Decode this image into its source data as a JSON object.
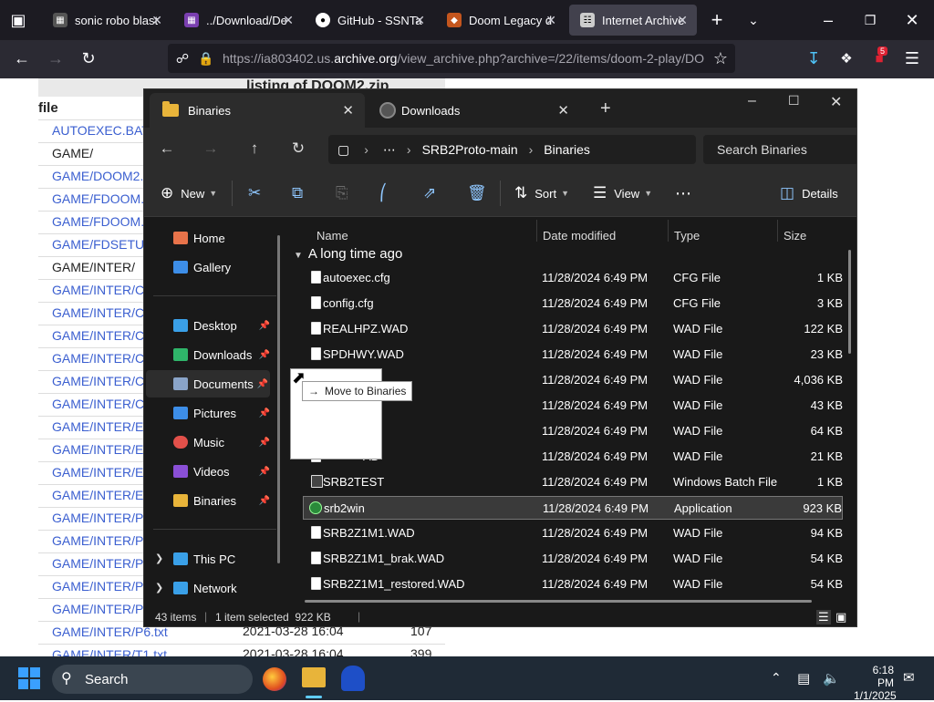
{
  "browser": {
    "tabs": [
      {
        "label": "sonic robo blast",
        "icon": "page-icon"
      },
      {
        "label": "../Download/De",
        "icon": "page-icon"
      },
      {
        "label": "GitHub - SSNTa",
        "icon": "github-icon"
      },
      {
        "label": "Doom Legacy d",
        "icon": "page-icon"
      },
      {
        "label": "Internet Archive",
        "icon": "archive-icon"
      }
    ],
    "url_prefix": "https://ia803402.us.",
    "url_domain": "archive.org",
    "url_rest": "/view_archive.php?archive=/22/items/doom-2-play/DO",
    "extension_badge": "5"
  },
  "webpage": {
    "title": "listing of DOOM2.zip",
    "column_header": "file",
    "rows": [
      "AUTOEXEC.BAT",
      "GAME/",
      "GAME/DOOM2.",
      "GAME/FDOOM.",
      "GAME/FDOOM.",
      "GAME/FDSETU",
      "GAME/INTER/",
      "GAME/INTER/C",
      "GAME/INTER/C",
      "GAME/INTER/C",
      "GAME/INTER/C",
      "GAME/INTER/C",
      "GAME/INTER/C",
      "GAME/INTER/E",
      "GAME/INTER/E",
      "GAME/INTER/E",
      "GAME/INTER/E",
      "GAME/INTER/P",
      "GAME/INTER/P",
      "GAME/INTER/P",
      "GAME/INTER/P",
      "GAME/INTER/P",
      "GAME/INTER/P6.txt",
      "GAME/INTER/T1.txt"
    ],
    "bottom_rows": [
      {
        "date": "2021-03-28 16:04",
        "size": "107"
      },
      {
        "date": "2021-03-28 16:04",
        "size": "399"
      }
    ]
  },
  "explorer": {
    "tabs": [
      {
        "label": "Binaries"
      },
      {
        "label": "Downloads"
      }
    ],
    "breadcrumb": [
      "SRB2Proto-main",
      "Binaries"
    ],
    "search_placeholder": "Search Binaries",
    "commands": {
      "new": "New",
      "sort": "Sort",
      "view": "View",
      "details": "Details"
    },
    "sidebar": {
      "top": [
        "Home",
        "Gallery"
      ],
      "pinned": [
        "Desktop",
        "Downloads",
        "Documents",
        "Pictures",
        "Music",
        "Videos",
        "Binaries"
      ],
      "bottom": [
        "This PC",
        "Network"
      ]
    },
    "columns": {
      "name": "Name",
      "date": "Date modified",
      "type": "Type",
      "size": "Size"
    },
    "group": "A long time ago",
    "files": [
      {
        "name": "autoexec.cfg",
        "date": "11/28/2024 6:49 PM",
        "type": "CFG File",
        "size": "1 KB"
      },
      {
        "name": "config.cfg",
        "date": "11/28/2024 6:49 PM",
        "type": "CFG File",
        "size": "3 KB"
      },
      {
        "name": "REALHPZ.WAD",
        "date": "11/28/2024 6:49 PM",
        "type": "WAD File",
        "size": "122 KB"
      },
      {
        "name": "SPDHWY.WAD",
        "date": "11/28/2024 6:49 PM",
        "type": "WAD File",
        "size": "23 KB"
      },
      {
        "name": "",
        "date": "11/28/2024 6:49 PM",
        "type": "WAD File",
        "size": "4,036 KB"
      },
      {
        "name": "AD",
        "date": "11/28/2024 6:49 PM",
        "type": "WAD File",
        "size": "43 KB"
      },
      {
        "name": "AD",
        "date": "11/28/2024 6:49 PM",
        "type": "WAD File",
        "size": "64 KB"
      },
      {
        "name": "AD",
        "date": "11/28/2024 6:49 PM",
        "type": "WAD File",
        "size": "21 KB"
      },
      {
        "name": "SRB2TEST",
        "date": "11/28/2024 6:49 PM",
        "type": "Windows Batch File",
        "size": "1 KB"
      },
      {
        "name": "srb2win",
        "date": "11/28/2024 6:49 PM",
        "type": "Application",
        "size": "923 KB"
      },
      {
        "name": "SRB2Z1M1.WAD",
        "date": "11/28/2024 6:49 PM",
        "type": "WAD File",
        "size": "94 KB"
      },
      {
        "name": "SRB2Z1M1_brak.WAD",
        "date": "11/28/2024 6:49 PM",
        "type": "WAD File",
        "size": "54 KB"
      },
      {
        "name": "SRB2Z1M1_restored.WAD",
        "date": "11/28/2024 6:49 PM",
        "type": "WAD File",
        "size": "54 KB"
      }
    ],
    "drag_tooltip": "Move to Binaries",
    "status": {
      "items": "43 items",
      "selected": "1 item selected  922 KB"
    }
  },
  "taskbar": {
    "search": "Search",
    "time": "6:18 PM",
    "date": "1/1/2025"
  },
  "colors": {
    "link": "#3b5fd0",
    "explorer_bg": "#191919",
    "accent": "#8fc7ff"
  }
}
